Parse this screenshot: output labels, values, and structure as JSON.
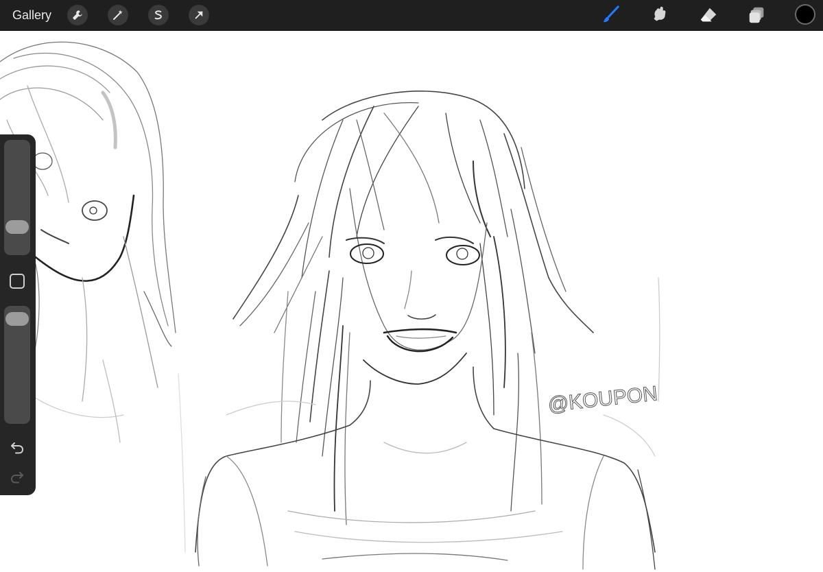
{
  "toolbar": {
    "gallery_label": "Gallery",
    "left_tools": [
      "actions-wrench",
      "adjustments-magic-wand",
      "selection",
      "transform-arrow"
    ],
    "right_tools": [
      "brush",
      "smudge",
      "eraser",
      "layers"
    ],
    "active_tool": "brush",
    "active_tool_color": "#1f7aff",
    "current_color": "#000000"
  },
  "sidebar": {
    "brush_size_level": 0.2,
    "opacity_level": 0.95,
    "undo_enabled": true,
    "redo_enabled": false
  },
  "canvas": {
    "signature": "@KOUPON"
  }
}
